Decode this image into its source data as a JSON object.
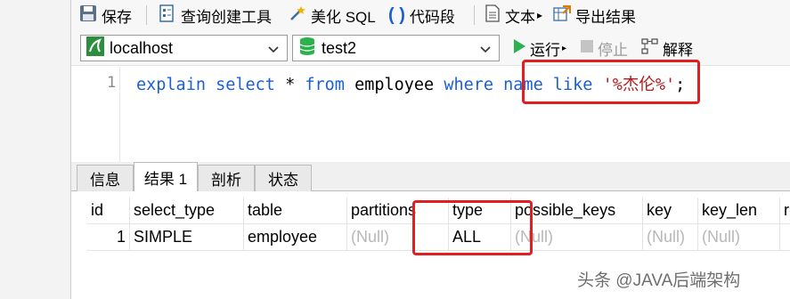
{
  "toolbar": {
    "save": "保存",
    "query_builder": "查询创建工具",
    "beautify_sql": "美化 SQL",
    "code_snippet": "代码段",
    "text": "文本",
    "export_results": "导出结果"
  },
  "connection": {
    "host": "localhost",
    "database": "test2",
    "run": "运行",
    "stop": "停止",
    "explain": "解释"
  },
  "editor": {
    "line_number": "1",
    "tokens": {
      "explain": "explain",
      "select": "select",
      "star": "*",
      "from": "from",
      "table": "employee",
      "where": "where",
      "column": "name",
      "like": "like",
      "pattern": "'%杰伦%'",
      "semicolon": ";"
    }
  },
  "tabs": [
    "信息",
    "结果 1",
    "剖析",
    "状态"
  ],
  "grid": {
    "columns": [
      "id",
      "select_type",
      "table",
      "partitions",
      "type",
      "possible_keys",
      "key",
      "key_len",
      "r"
    ],
    "row": [
      "1",
      "SIMPLE",
      "employee",
      "(Null)",
      "ALL",
      "(Null)",
      "(Null)",
      "(Null)",
      ""
    ]
  },
  "watermark": "头条 @JAVA后端架构",
  "colors": {
    "keyword": "#1a5fd6",
    "string": "#b01d1d",
    "highlight": "#e02020",
    "run_green": "#2bb24c"
  }
}
